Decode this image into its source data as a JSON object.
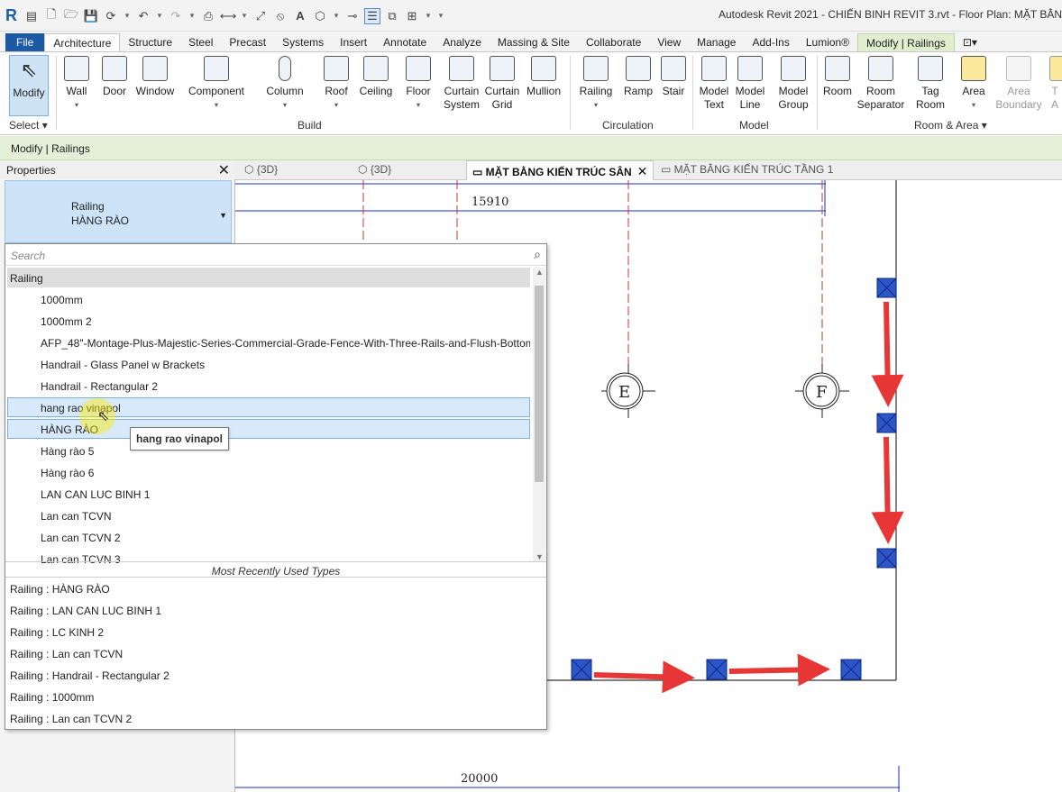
{
  "titlebar": {
    "app_logo": "R",
    "title": "Autodesk Revit 2021 - CHIẾN BINH REVIT 3.rvt - Floor Plan: MẶT BẰN"
  },
  "ribbon_tabs": [
    "File",
    "Architecture",
    "Structure",
    "Steel",
    "Precast",
    "Systems",
    "Insert",
    "Annotate",
    "Analyze",
    "Massing & Site",
    "Collaborate",
    "View",
    "Manage",
    "Add-Ins",
    "Lumion®",
    "Modify | Railings"
  ],
  "ribbon": {
    "modify": "Modify",
    "select": "Select",
    "build": {
      "wall": "Wall",
      "door": "Door",
      "window": "Window",
      "component": "Component",
      "column": "Column",
      "roof": "Roof",
      "ceiling": "Ceiling",
      "floor": "Floor",
      "curtain_system_1": "Curtain",
      "curtain_system_2": "System",
      "curtain_grid_1": "Curtain",
      "curtain_grid_2": "Grid",
      "mullion": "Mullion",
      "label": "Build"
    },
    "circulation": {
      "railing": "Railing",
      "ramp": "Ramp",
      "stair": "Stair",
      "label": "Circulation"
    },
    "model": {
      "model_text_1": "Model",
      "model_text_2": "Text",
      "model_line_1": "Model",
      "model_line_2": "Line",
      "model_group_1": "Model",
      "model_group_2": "Group",
      "label": "Model"
    },
    "room_area": {
      "room": "Room",
      "room_sep_1": "Room",
      "room_sep_2": "Separator",
      "tag_room_1": "Tag",
      "tag_room_2": "Room",
      "area": "Area",
      "area_boundary_1": "Area",
      "area_boundary_2": "Boundary",
      "tag_area_1": "T",
      "tag_area_2": "A",
      "label": "Room & Area"
    }
  },
  "context_bar": "Modify | Railings",
  "properties": {
    "title": "Properties",
    "type_family": "Railing",
    "type_name": "HÀNG RÀO"
  },
  "view_tabs": [
    "{3D}",
    "{3D}",
    "MẶT BẰNG KIẾN TRÚC SÂN",
    "MẶT BẰNG KIẾN TRÚC TẦNG 1"
  ],
  "dropdown": {
    "search_placeholder": "Search",
    "group": "Railing",
    "items": [
      "1000mm",
      "1000mm 2",
      "AFP_48\"-Montage-Plus-Majestic-Series-Commercial-Grade-Fence-With-Three-Rails-and-Flush-Bottom",
      "Handrail - Glass Panel w Brackets",
      "Handrail - Rectangular 2",
      "hang rao vinapol",
      "HÀNG RÀO",
      "Hàng rào 5",
      "Hàng rào 6",
      "LAN CAN LUC BINH 1",
      "Lan can TCVN",
      "Lan can TCVN 2",
      "Lan can TCVN 3"
    ],
    "mru_header": "Most Recently Used Types",
    "mru": [
      "Railing : HÀNG RÀO",
      "Railing : LAN CAN LUC BINH 1",
      "Railing : LC KINH 2",
      "Railing : Lan can TCVN",
      "Railing : Handrail - Rectangular 2",
      "Railing : 1000mm",
      "Railing : Lan can TCVN 2"
    ]
  },
  "tooltip": "hang rao vinapol",
  "drawing": {
    "dim_top": "15910",
    "dim_bottom": "20000",
    "grid_e": "E",
    "grid_f": "F"
  },
  "colors": {
    "accent": "#1c5aa6",
    "context_tab": "#dfeecf",
    "selection": "#cde3f8",
    "arrow": "#e83535",
    "post": "#2f56c6",
    "grid_line": "#c0392b"
  }
}
